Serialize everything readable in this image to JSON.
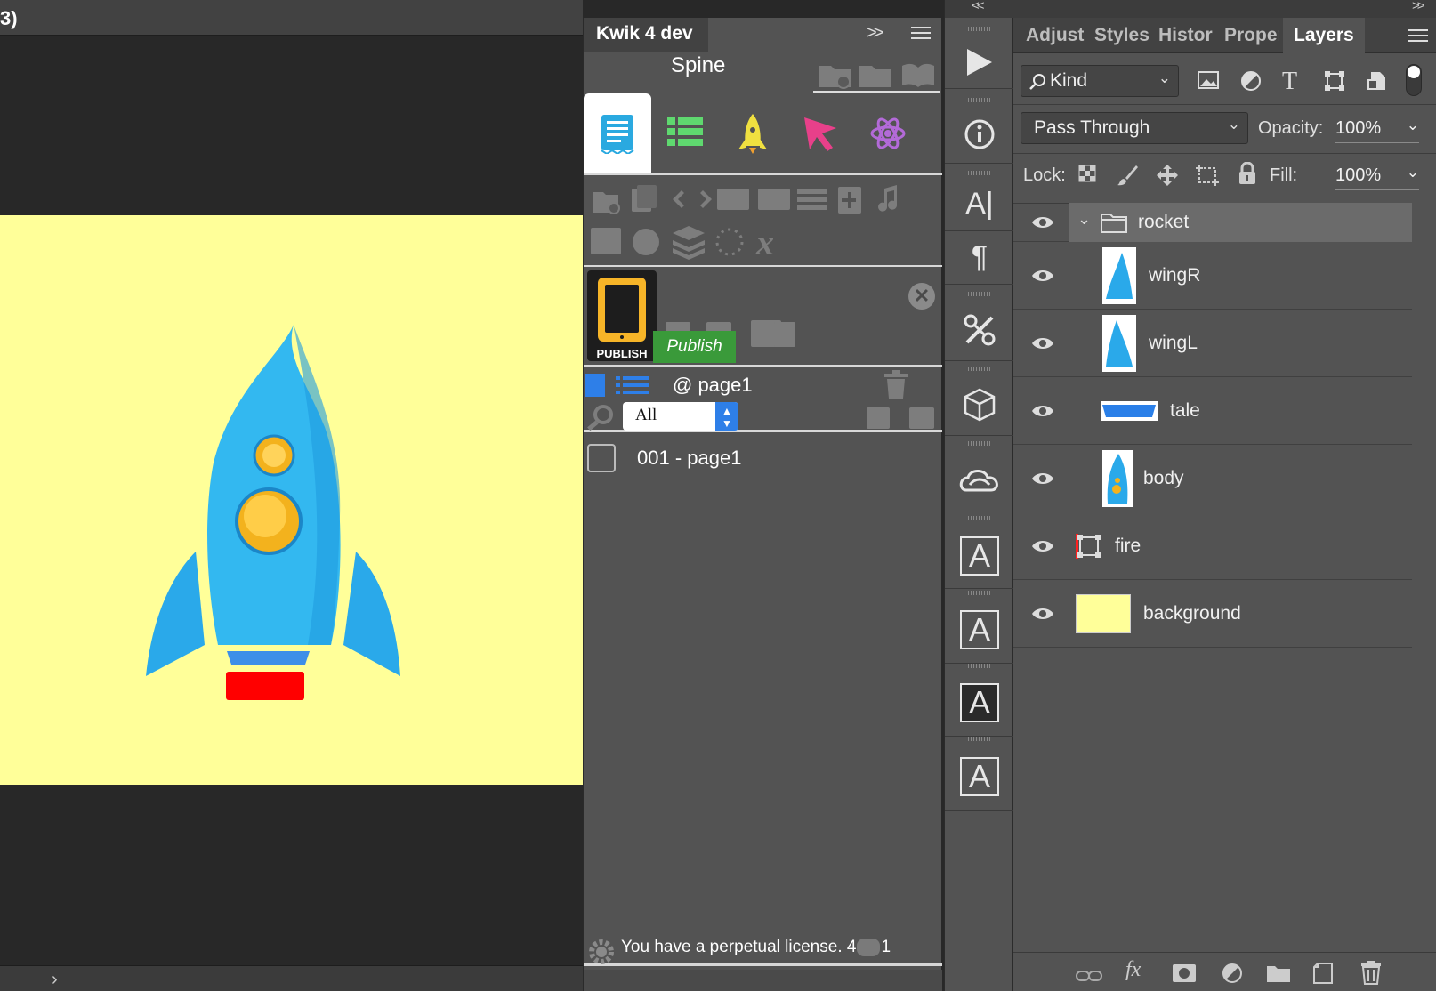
{
  "document": {
    "tab_text": "3)",
    "artboard_color": "#ffff99",
    "status_arrow": "›"
  },
  "kwik": {
    "tab_label": "Kwik 4 dev",
    "collapse": ">>",
    "subtitle": "Spine",
    "publish_label": "PUBLISH",
    "publish_button": "Publish",
    "close": "✕",
    "page_name": "@ page1",
    "filter_value": "All",
    "page_item": "001 - page1",
    "license_text": "You have a perpetual license. 4",
    "license_suffix": "1",
    "colors": {
      "accent_blue": "#2aa9e0",
      "rocket": "#f0e040",
      "cursor": "#e8408a",
      "atom": "#b36ad8",
      "publish_green": "#3a9a3a"
    }
  },
  "toolstrip": {
    "collapse": "<<",
    "char_glyph": "A|",
    "para_glyph": "¶",
    "boxA": "A"
  },
  "layers_panel": {
    "collapse": ">>",
    "tabs": [
      "Adjust",
      "Styles",
      "Histor",
      "Proper",
      "Layers"
    ],
    "kind_label": "Kind",
    "blend_mode": "Pass Through",
    "opacity_label": "Opacity:",
    "opacity_value": "100%",
    "lock_label": "Lock:",
    "fill_label": "Fill:",
    "fill_value": "100%",
    "layers": [
      {
        "name": "rocket",
        "type": "group"
      },
      {
        "name": "wingR",
        "type": "image"
      },
      {
        "name": "wingL",
        "type": "image"
      },
      {
        "name": "tale",
        "type": "image"
      },
      {
        "name": "body",
        "type": "image"
      },
      {
        "name": "fire",
        "type": "shape"
      },
      {
        "name": "background",
        "type": "fill"
      }
    ],
    "fx_label": "fx"
  }
}
